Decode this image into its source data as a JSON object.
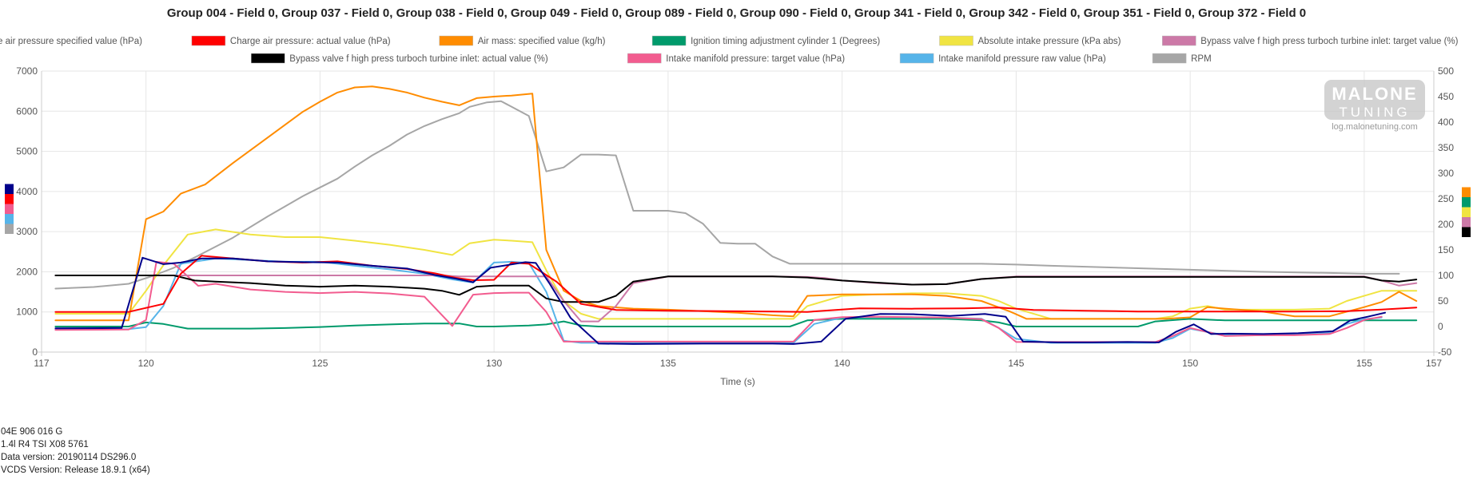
{
  "chart_data": {
    "type": "line",
    "title": "Group 004 - Field 0, Group 037 - Field 0, Group 038 - Field 0, Group 049 - Field 0, Group 089 - Field 0, Group 090 - Field 0, Group 341 - Field 0, Group 342 - Field 0, Group 351 - Field 0, Group 372 - Field 0",
    "xlabel": "Time (s)",
    "xlim": [
      117,
      157
    ],
    "xticks": [
      117,
      120,
      125,
      130,
      135,
      140,
      145,
      150,
      155,
      157
    ],
    "ylim_left": [
      0,
      7000
    ],
    "yticks_left": [
      0,
      1000,
      2000,
      3000,
      4000,
      5000,
      6000,
      7000
    ],
    "ylim_right": [
      -50,
      500
    ],
    "yticks_right": [
      -50,
      0,
      50,
      100,
      150,
      200,
      250,
      300,
      350,
      400,
      450,
      500
    ],
    "grid": true,
    "legend_position": "top",
    "series": [
      {
        "name": "Charge air pressure specified value (hPa)",
        "color": "#00008b",
        "axis": "left",
        "x": [
          117.4,
          119.3,
          119.9,
          120.5,
          121.0,
          121.6,
          122.5,
          123.5,
          124.5,
          125.5,
          126.5,
          127.5,
          128.3,
          128.9,
          129.4,
          129.9,
          130.9,
          131.2,
          131.6,
          132.2,
          133.0,
          134.0,
          136.0,
          138.0,
          138.6,
          139.4,
          140.1,
          141.1,
          142.1,
          143.1,
          144.1,
          144.7,
          145.2,
          146.2,
          147.2,
          148.2,
          149.1,
          149.6,
          150.1,
          150.6,
          151.1,
          152.1,
          153.1,
          154.1,
          154.6,
          155.1,
          155.6
        ],
        "y": [
          590,
          600,
          2350,
          2190,
          2230,
          2330,
          2330,
          2260,
          2240,
          2230,
          2150,
          2080,
          1920,
          1830,
          1740,
          2100,
          2240,
          2220,
          1700,
          850,
          210,
          200,
          210,
          210,
          200,
          260,
          830,
          950,
          940,
          900,
          950,
          880,
          260,
          240,
          240,
          250,
          240,
          510,
          690,
          450,
          460,
          450,
          470,
          520,
          790,
          880,
          980
        ]
      },
      {
        "name": "Charge air pressure: actual value (hPa)",
        "color": "#ff0000",
        "axis": "left",
        "x": [
          117.4,
          119.5,
          120.5,
          121.0,
          121.6,
          122.5,
          123.5,
          124.5,
          125.5,
          126.5,
          127.5,
          128.3,
          128.9,
          129.4,
          130.0,
          130.5,
          131.0,
          131.8,
          132.5,
          133.5,
          135.0,
          136.5,
          138.0,
          139.0,
          140.5,
          142.0,
          143.5,
          144.5,
          145.5,
          147.0,
          148.5,
          150.0,
          151.5,
          153.0,
          154.5,
          155.5,
          156.5
        ],
        "y": [
          1000,
          1000,
          1200,
          1950,
          2400,
          2330,
          2260,
          2230,
          2260,
          2150,
          2070,
          1960,
          1850,
          1790,
          1800,
          2230,
          2200,
          1750,
          1200,
          1050,
          1030,
          1020,
          1010,
          1000,
          1090,
          1080,
          1090,
          1110,
          1050,
          1030,
          1010,
          1010,
          1010,
          1010,
          1020,
          1060,
          1110
        ]
      },
      {
        "name": "Air mass: specified value (kg/h)",
        "color": "#ff8c00",
        "axis": "right",
        "x": [
          117.4,
          119.5,
          120.0,
          120.5,
          121.0,
          121.7,
          122.5,
          123.5,
          124.5,
          125.0,
          125.5,
          126.0,
          126.5,
          127.0,
          127.5,
          128.0,
          128.5,
          129.0,
          129.5,
          130.0,
          130.5,
          131.1,
          131.5,
          132.0,
          132.5,
          133.0,
          134.0,
          135.0,
          136.0,
          137.0,
          138.0,
          138.6,
          139.0,
          140.0,
          141.0,
          142.0,
          143.0,
          144.0,
          144.8,
          145.3,
          146.3,
          147.3,
          148.3,
          149.3,
          150.0,
          150.5,
          151.0,
          152.0,
          153.0,
          154.0,
          155.0,
          155.5,
          156.0,
          156.5
        ],
        "y": [
          12,
          12,
          210,
          225,
          260,
          278,
          320,
          370,
          420,
          440,
          458,
          468,
          470,
          465,
          458,
          448,
          440,
          433,
          447,
          450,
          452,
          456,
          150,
          70,
          50,
          40,
          35,
          33,
          30,
          27,
          22,
          20,
          60,
          63,
          63,
          63,
          60,
          50,
          30,
          15,
          15,
          15,
          15,
          15,
          18,
          38,
          35,
          30,
          20,
          20,
          38,
          48,
          68,
          50
        ]
      },
      {
        "name": "Ignition timing adjustment cylinder 1 (Degrees)",
        "color": "#009a6b",
        "axis": "right",
        "x": [
          117.4,
          119.5,
          120.0,
          120.5,
          121.2,
          122.0,
          123.0,
          124.0,
          125.0,
          126.0,
          127.0,
          128.0,
          129.0,
          129.5,
          130.0,
          131.0,
          131.5,
          132.0,
          132.5,
          133.0,
          134.0,
          135.0,
          136.0,
          137.0,
          138.0,
          138.5,
          139.0,
          140.0,
          141.0,
          142.0,
          143.0,
          144.0,
          144.5,
          145.0,
          146.0,
          147.0,
          148.0,
          148.5,
          149.0,
          150.0,
          151.0,
          152.0,
          153.0,
          154.0,
          155.0,
          156.5
        ],
        "y": [
          0,
          0,
          8,
          5,
          -4,
          -4,
          -4,
          -3,
          -1,
          2,
          4,
          6,
          6,
          0,
          0,
          2,
          4,
          10,
          2,
          0,
          0,
          0,
          0,
          0,
          0,
          0,
          12,
          15,
          15,
          15,
          15,
          12,
          8,
          0,
          0,
          0,
          0,
          0,
          10,
          15,
          12,
          12,
          12,
          12,
          12,
          12
        ]
      },
      {
        "name": "Absolute intake pressure (kPa abs)",
        "color": "#f0e442",
        "axis": "right",
        "x": [
          117.4,
          119.5,
          120.0,
          120.5,
          121.2,
          122.0,
          123.0,
          124.0,
          125.0,
          126.0,
          127.0,
          128.0,
          128.8,
          129.3,
          130.0,
          130.5,
          131.1,
          131.5,
          132.0,
          132.5,
          133.0,
          134.0,
          135.0,
          136.0,
          137.0,
          138.0,
          138.6,
          139.0,
          140.0,
          141.0,
          142.0,
          143.0,
          144.0,
          144.5,
          145.0,
          146.0,
          147.0,
          148.0,
          149.0,
          149.5,
          150.0,
          150.5,
          151.0,
          152.0,
          153.0,
          154.0,
          154.5,
          155.0,
          155.5,
          156.0,
          156.5
        ],
        "y": [
          25,
          25,
          70,
          120,
          180,
          190,
          180,
          175,
          175,
          168,
          160,
          150,
          140,
          163,
          170,
          168,
          165,
          110,
          50,
          25,
          15,
          15,
          15,
          15,
          15,
          15,
          15,
          40,
          60,
          63,
          65,
          65,
          60,
          50,
          35,
          15,
          15,
          15,
          15,
          20,
          35,
          40,
          33,
          33,
          33,
          35,
          50,
          60,
          70,
          70,
          70
        ]
      },
      {
        "name": "Bypass valve f high press turboch turbine inlet: target value (%)",
        "color": "#cc79a7",
        "axis": "right",
        "x": [
          117.4,
          119.5,
          120.0,
          120.5,
          121.0,
          121.6,
          122.5,
          123.5,
          124.5,
          125.5,
          126.5,
          127.5,
          128.5,
          129.0,
          129.5,
          130.0,
          130.5,
          131.0,
          131.5,
          132.0,
          132.5,
          133.0,
          133.5,
          134.0,
          135.0,
          136.0,
          137.0,
          138.0,
          139.0,
          139.5,
          140.0,
          141.0,
          142.0,
          143.0,
          144.0,
          145.0,
          146.0,
          148.0,
          150.0,
          152.0,
          154.0,
          155.0,
          155.5,
          156.0,
          156.5
        ],
        "y": [
          100,
          100,
          100,
          100,
          100,
          100,
          100,
          100,
          100,
          100,
          100,
          100,
          100,
          98,
          98,
          98,
          98,
          98,
          98,
          50,
          10,
          10,
          40,
          85,
          98,
          98,
          98,
          98,
          97,
          95,
          90,
          85,
          82,
          83,
          93,
          98,
          98,
          98,
          98,
          98,
          98,
          98,
          90,
          80,
          85
        ]
      },
      {
        "name": "Bypass valve f high press turboch turbine inlet: actual value (%)",
        "color": "#000000",
        "axis": "right",
        "x": [
          117.4,
          119.5,
          120.2,
          120.8,
          121.4,
          122.0,
          123.0,
          124.0,
          125.0,
          126.0,
          127.0,
          128.0,
          128.5,
          129.0,
          129.5,
          130.0,
          130.5,
          131.0,
          131.5,
          132.0,
          132.5,
          133.0,
          133.5,
          134.0,
          135.0,
          136.0,
          137.0,
          138.0,
          139.0,
          139.5,
          140.0,
          141.0,
          142.0,
          143.0,
          144.0,
          145.0,
          146.0,
          148.0,
          150.0,
          152.0,
          154.0,
          155.0,
          155.5,
          156.0,
          156.5
        ],
        "y": [
          100,
          100,
          100,
          100,
          90,
          88,
          85,
          80,
          78,
          80,
          78,
          74,
          70,
          62,
          78,
          80,
          80,
          80,
          55,
          48,
          48,
          48,
          60,
          88,
          98,
          98,
          98,
          98,
          96,
          93,
          90,
          86,
          82,
          83,
          93,
          97,
          97,
          97,
          97,
          97,
          97,
          97,
          90,
          88,
          92
        ]
      },
      {
        "name": "Intake manifold pressure: target value (hPa)",
        "color": "#f25c8f",
        "axis": "left",
        "x": [
          117.4,
          119.5,
          120.0,
          120.3,
          120.8,
          121.5,
          122.0,
          123.0,
          124.0,
          125.0,
          126.0,
          127.0,
          128.0,
          128.8,
          129.4,
          130.0,
          130.5,
          131.0,
          131.5,
          132.0,
          132.5,
          133.0,
          134.0,
          135.0,
          136.0,
          137.0,
          138.0,
          138.6,
          139.2,
          140.0,
          141.0,
          142.0,
          143.0,
          144.0,
          144.5,
          145.0,
          146.0,
          147.0,
          148.0,
          149.0,
          149.5,
          150.0,
          150.5,
          151.0,
          152.0,
          153.0,
          154.0,
          154.5,
          155.0,
          155.5
        ],
        "y": [
          550,
          560,
          800,
          2250,
          2200,
          1650,
          1700,
          1560,
          1500,
          1470,
          1500,
          1460,
          1380,
          650,
          1430,
          1470,
          1480,
          1480,
          1000,
          260,
          260,
          260,
          260,
          260,
          260,
          260,
          260,
          260,
          800,
          870,
          880,
          870,
          860,
          820,
          600,
          250,
          250,
          250,
          250,
          250,
          400,
          600,
          500,
          400,
          420,
          420,
          450,
          600,
          800,
          880
        ]
      },
      {
        "name": "Intake manifold pressure raw value (hPa)",
        "color": "#56b4e9",
        "axis": "left",
        "x": [
          117.4,
          119.5,
          120.0,
          120.5,
          121.0,
          122.0,
          123.0,
          124.0,
          125.0,
          126.0,
          127.0,
          128.0,
          128.8,
          129.4,
          130.0,
          130.5,
          131.0,
          131.5,
          132.0,
          132.5,
          133.0,
          134.0,
          135.0,
          136.0,
          137.0,
          138.0,
          138.6,
          139.2,
          140.0,
          141.0,
          142.0,
          143.0,
          144.0,
          144.5,
          145.0,
          146.0,
          147.0,
          148.0,
          149.0,
          149.5,
          150.0,
          150.5,
          151.0,
          152.0,
          153.0,
          154.0,
          154.5,
          155.0,
          155.5
        ],
        "y": [
          560,
          570,
          620,
          1150,
          2200,
          2330,
          2290,
          2250,
          2250,
          2150,
          2060,
          1950,
          1810,
          1730,
          2230,
          2250,
          2220,
          1500,
          280,
          230,
          230,
          230,
          230,
          230,
          230,
          230,
          230,
          700,
          860,
          870,
          860,
          860,
          830,
          600,
          330,
          230,
          230,
          230,
          230,
          350,
          580,
          500,
          420,
          420,
          430,
          480,
          700,
          820,
          860
        ]
      },
      {
        "name": "RPM",
        "color": "#a6a6a6",
        "axis": "left",
        "x": [
          117.4,
          118.5,
          119.5,
          120.2,
          120.8,
          121.5,
          122.5,
          123.5,
          124.5,
          125.0,
          125.5,
          126.0,
          126.5,
          127.0,
          127.5,
          128.0,
          128.5,
          129.0,
          129.3,
          129.8,
          130.2,
          131.0,
          131.5,
          132.0,
          132.5,
          133.0,
          133.5,
          134.0,
          134.5,
          135.0,
          135.5,
          136.0,
          136.5,
          137.0,
          137.5,
          138.0,
          138.5,
          139.0,
          140.0,
          142.0,
          144.0,
          145.0,
          146.0,
          148.0,
          150.0,
          152.0,
          154.0,
          155.0,
          156.0
        ],
        "y": [
          1580,
          1620,
          1700,
          1900,
          2100,
          2400,
          2850,
          3380,
          3880,
          4100,
          4320,
          4620,
          4900,
          5140,
          5420,
          5630,
          5800,
          5950,
          6110,
          6220,
          6250,
          5880,
          4500,
          4600,
          4920,
          4920,
          4900,
          3520,
          3520,
          3520,
          3460,
          3200,
          2720,
          2700,
          2700,
          2380,
          2200,
          2200,
          2200,
          2200,
          2200,
          2180,
          2150,
          2100,
          2050,
          2000,
          1970,
          1950,
          1950
        ]
      }
    ]
  },
  "watermark": {
    "brand_top": "MALONE",
    "brand_bottom": "TUNING",
    "url": "log.malonetuning.com"
  },
  "info": {
    "line1": "04E 906 016 G",
    "line2": "1.4l R4 TSI    X08 5761",
    "line3": "Data version: 20190114 DS296.0",
    "line4": "VCDS Version: Release 18.9.1 (x64)"
  }
}
